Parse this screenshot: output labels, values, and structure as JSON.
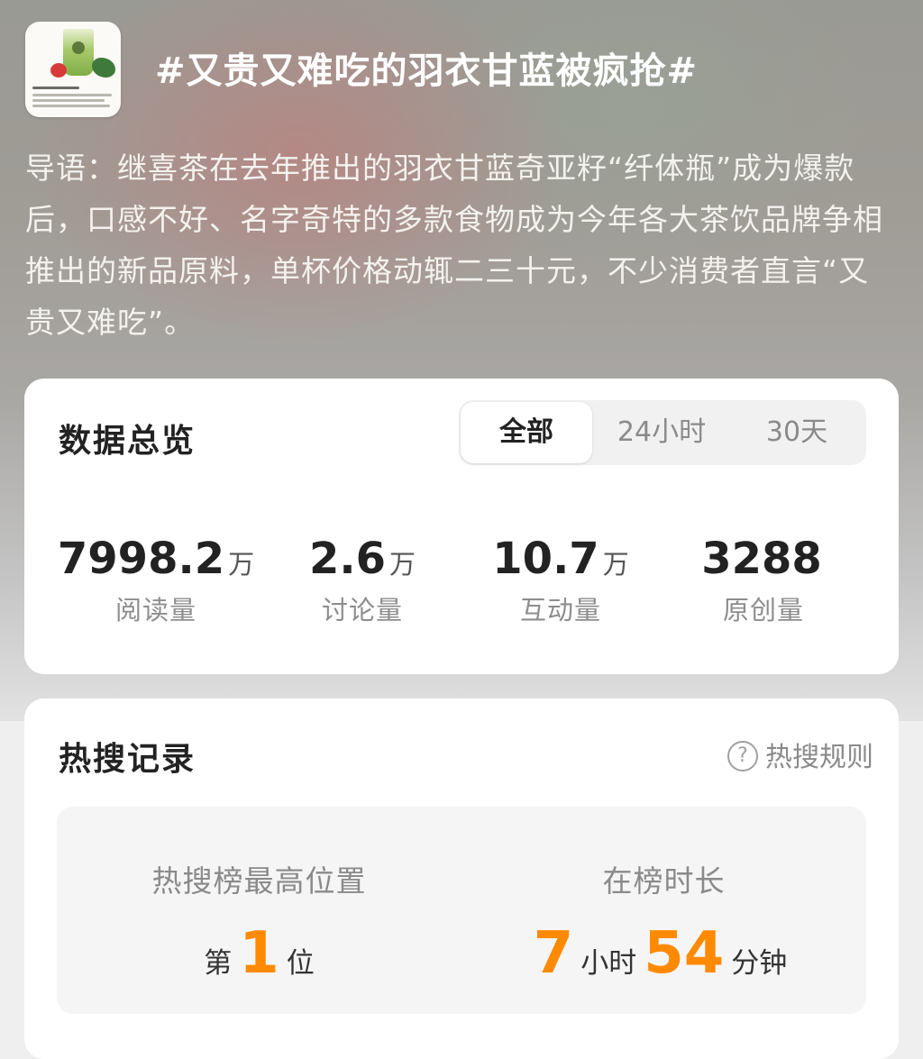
{
  "topic": {
    "title": "#又贵又难吃的羽衣甘蓝被疯抢#",
    "lead": "导语：继喜茶在去年推出的羽衣甘蓝奇亚籽“纤体瓶”成为爆款后，口感不好、名字奇特的多款食物成为今年各大茶饮品牌争相推出的新品原料，单杯价格动辄二三十元，不少消费者直言“又贵又难吃”。"
  },
  "overview": {
    "title": "数据总览",
    "tabs": [
      "全部",
      "24小时",
      "30天"
    ],
    "active_tab": "全部",
    "stats": [
      {
        "value": "7998.2",
        "unit": "万",
        "label": "阅读量"
      },
      {
        "value": "2.6",
        "unit": "万",
        "label": "讨论量"
      },
      {
        "value": "10.7",
        "unit": "万",
        "label": "互动量"
      },
      {
        "value": "3288",
        "unit": "",
        "label": "原创量"
      }
    ]
  },
  "hot_search": {
    "title": "热搜记录",
    "rules_label": "热搜规则",
    "rules_icon": "question-circle-icon",
    "peak": {
      "heading": "热搜榜最高位置",
      "prefix": "第",
      "value": "1",
      "suffix": "位"
    },
    "duration": {
      "heading": "在榜时长",
      "hours": "7",
      "hours_unit": "小时",
      "minutes": "54",
      "minutes_unit": "分钟"
    }
  },
  "colors": {
    "accent": "#ff8a00",
    "card": "#ffffff"
  }
}
